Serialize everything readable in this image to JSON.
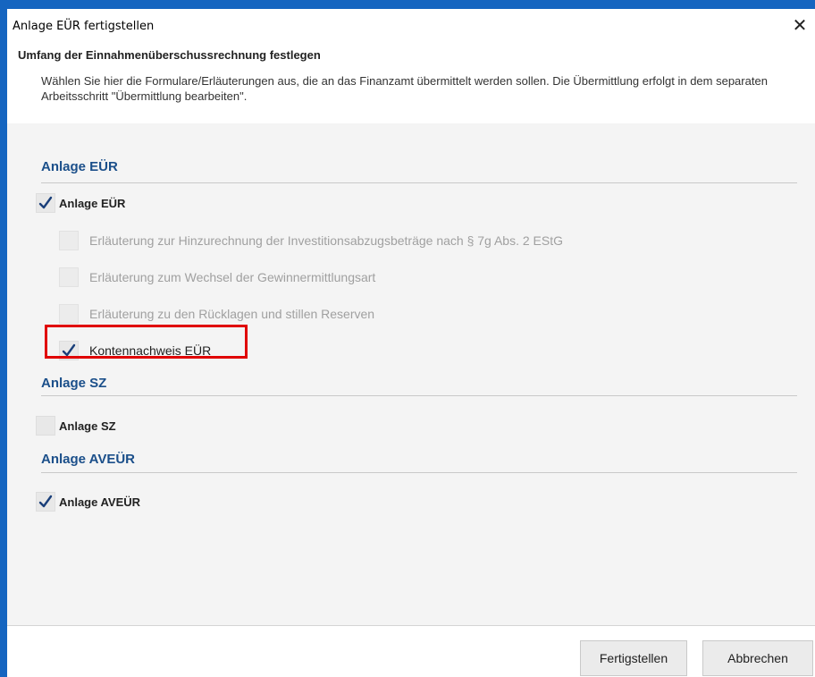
{
  "window": {
    "title": "Anlage EÜR fertigstellen",
    "close_glyph": "✕"
  },
  "header": {
    "heading": "Umfang der Einnahmenüberschussrechnung festlegen",
    "description": "Wählen Sie hier die Formulare/Erläuterungen aus, die an das Finanzamt übermittelt werden sollen. Die Übermittlung erfolgt in dem separaten Arbeitsschritt \"Übermittlung bearbeiten\"."
  },
  "sections": [
    {
      "title": "Anlage EÜR",
      "main": {
        "label": "Anlage EÜR",
        "checked": true
      },
      "sub_items": [
        {
          "label": "Erläuterung zur Hinzurechnung der Investitionsabzugsbeträge nach § 7g Abs. 2 EStG",
          "checked": false,
          "enabled": false
        },
        {
          "label": "Erläuterung zum Wechsel der Gewinnermittlungsart",
          "checked": false,
          "enabled": false
        },
        {
          "label": "Erläuterung zu den Rücklagen und stillen Reserven",
          "checked": false,
          "enabled": false
        },
        {
          "label": "Kontennachweis EÜR",
          "checked": true,
          "enabled": true,
          "highlighted": true
        }
      ]
    },
    {
      "title": "Anlage SZ",
      "main": {
        "label": "Anlage SZ",
        "checked": false
      }
    },
    {
      "title": "Anlage AVEÜR",
      "main": {
        "label": "Anlage AVEÜR",
        "checked": true
      }
    }
  ],
  "footer": {
    "finish_label": "Fertigstellen",
    "cancel_label": "Abbrechen"
  },
  "colors": {
    "section_title": "#1b4f8a",
    "checkmark": "#1a3f7a",
    "highlight_border": "#e00000",
    "window_frame": "#1565c0"
  },
  "icons": {
    "checkmark": "check-icon",
    "close": "close-icon"
  }
}
